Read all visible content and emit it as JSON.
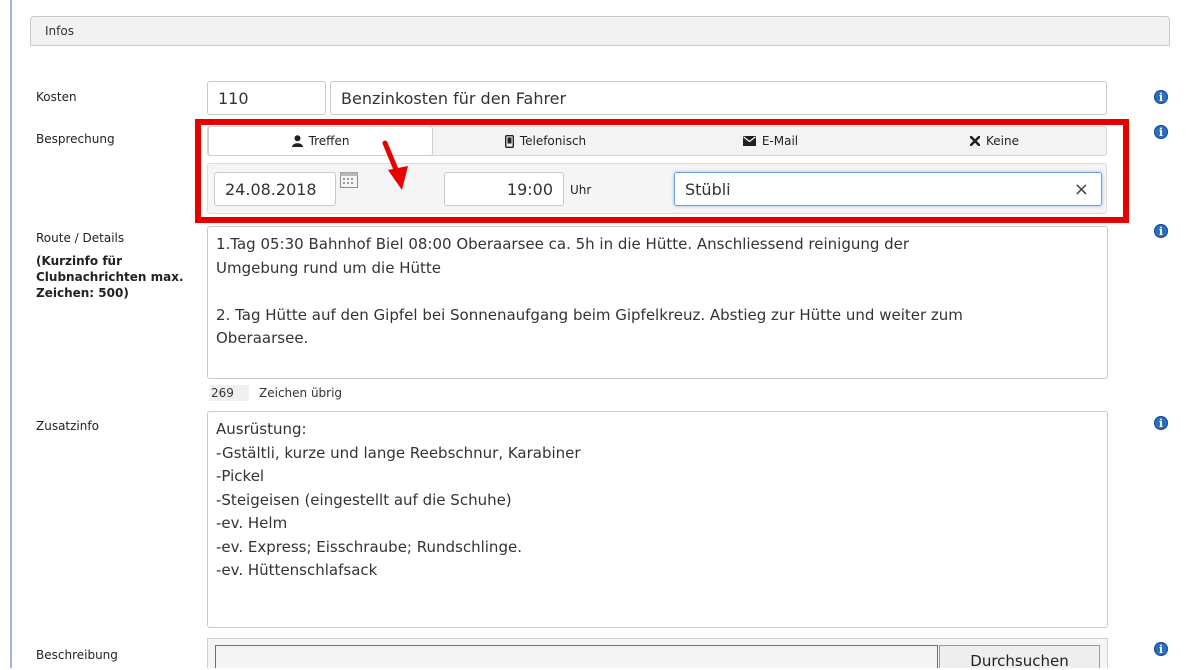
{
  "section": {
    "title": "Infos"
  },
  "kosten": {
    "label": "Kosten",
    "amount": "110",
    "description": "Benzinkosten für den Fahrer"
  },
  "besprechung": {
    "label": "Besprechung",
    "tabs": [
      {
        "label": "Treffen",
        "icon": "person-icon"
      },
      {
        "label": "Telefonisch",
        "icon": "phone-icon"
      },
      {
        "label": "E-Mail",
        "icon": "envelope-icon"
      },
      {
        "label": "Keine",
        "icon": "close-icon"
      }
    ],
    "date": "24.08.2018",
    "time": "19:00",
    "time_unit": "Uhr",
    "location": "Stübli"
  },
  "route": {
    "label": "Route / Details",
    "hint": "(Kurzinfo für Clubnachrichten max. Zeichen: 500)",
    "text": "1.Tag 05:30 Bahnhof Biel 08:00 Oberaarsee ca. 5h in die Hütte. Anschliessend reinigung der\nUmgebung rund um die Hütte\n\n2. Tag Hütte auf den Gipfel bei Sonnenaufgang beim Gipfelkreuz. Abstieg zur Hütte und weiter zum\nOberaarsee.",
    "remaining_count": "269",
    "remaining_label": "Zeichen übrig"
  },
  "zusatzinfo": {
    "label": "Zusatzinfo",
    "text": "Ausrüstung:\n-Gstältli, kurze und lange Reebschnur, Karabiner\n-Pickel\n-Steigeisen (eingestellt auf die Schuhe)\n-ev. Helm\n-ev. Express; Eisschraube; Rundschlinge.\n-ev. Hüttenschlafsack"
  },
  "beschreibung": {
    "label": "Beschreibung",
    "browse_label": "Durchsuchen"
  },
  "info_icon_glyph": "i",
  "clear_glyph": "×",
  "colors": {
    "highlight": "#e60000",
    "info": "#2b6cc4",
    "left_border": "#9fb4d8"
  }
}
